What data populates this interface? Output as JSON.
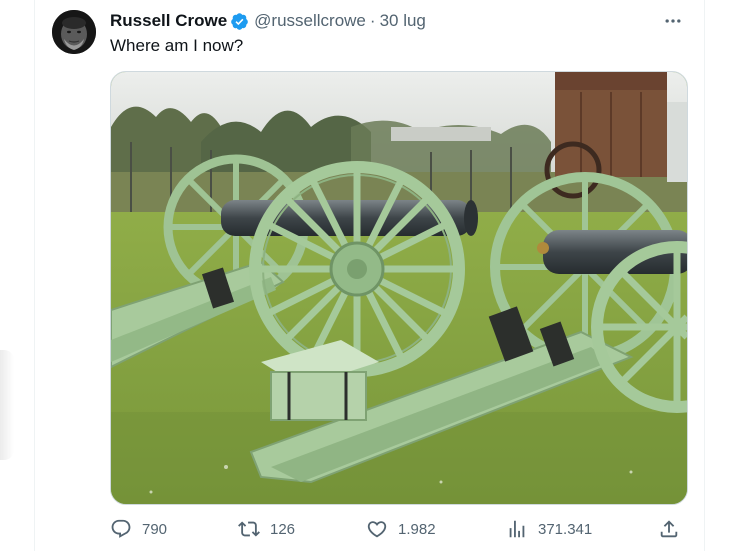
{
  "tweet": {
    "author": {
      "name": "Russell Crowe",
      "handle": "@russellcrowe",
      "verified": true,
      "verified_icon": "verified-badge-icon"
    },
    "separator": "·",
    "timestamp": "30 lug",
    "text": "Where am I now?",
    "media": {
      "icon": "photo-two-field-cannons"
    },
    "actions": {
      "replies": "790",
      "retweets": "126",
      "likes": "1.982",
      "views": "371.341"
    }
  },
  "colors": {
    "text_primary": "#0f1419",
    "text_secondary": "#536471",
    "verified_blue": "#1d9bf0",
    "border": "#cfd9de"
  }
}
